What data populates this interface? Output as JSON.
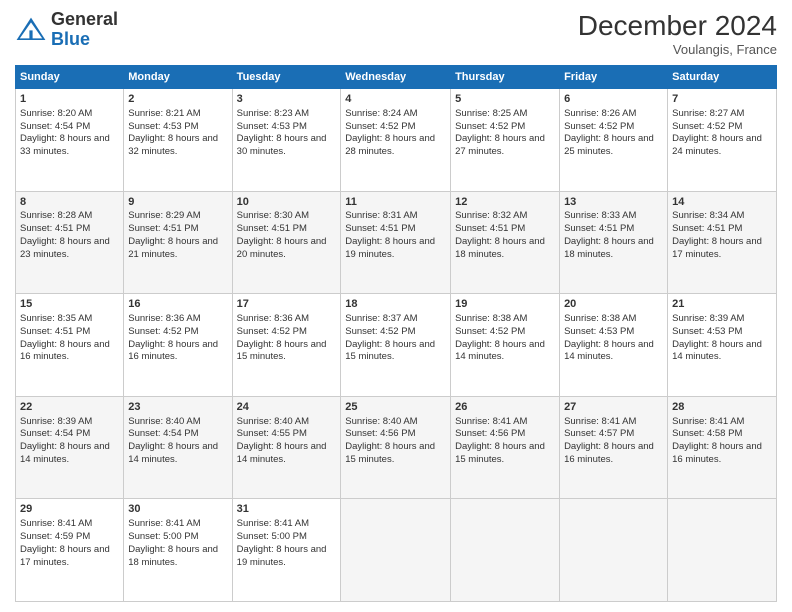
{
  "logo": {
    "line1": "General",
    "line2": "Blue"
  },
  "title": "December 2024",
  "location": "Voulangis, France",
  "days": [
    "Sunday",
    "Monday",
    "Tuesday",
    "Wednesday",
    "Thursday",
    "Friday",
    "Saturday"
  ],
  "weeks": [
    [
      {
        "day": "1",
        "sunrise": "Sunrise: 8:20 AM",
        "sunset": "Sunset: 4:54 PM",
        "daylight": "Daylight: 8 hours and 33 minutes."
      },
      {
        "day": "2",
        "sunrise": "Sunrise: 8:21 AM",
        "sunset": "Sunset: 4:53 PM",
        "daylight": "Daylight: 8 hours and 32 minutes."
      },
      {
        "day": "3",
        "sunrise": "Sunrise: 8:23 AM",
        "sunset": "Sunset: 4:53 PM",
        "daylight": "Daylight: 8 hours and 30 minutes."
      },
      {
        "day": "4",
        "sunrise": "Sunrise: 8:24 AM",
        "sunset": "Sunset: 4:52 PM",
        "daylight": "Daylight: 8 hours and 28 minutes."
      },
      {
        "day": "5",
        "sunrise": "Sunrise: 8:25 AM",
        "sunset": "Sunset: 4:52 PM",
        "daylight": "Daylight: 8 hours and 27 minutes."
      },
      {
        "day": "6",
        "sunrise": "Sunrise: 8:26 AM",
        "sunset": "Sunset: 4:52 PM",
        "daylight": "Daylight: 8 hours and 25 minutes."
      },
      {
        "day": "7",
        "sunrise": "Sunrise: 8:27 AM",
        "sunset": "Sunset: 4:52 PM",
        "daylight": "Daylight: 8 hours and 24 minutes."
      }
    ],
    [
      {
        "day": "8",
        "sunrise": "Sunrise: 8:28 AM",
        "sunset": "Sunset: 4:51 PM",
        "daylight": "Daylight: 8 hours and 23 minutes."
      },
      {
        "day": "9",
        "sunrise": "Sunrise: 8:29 AM",
        "sunset": "Sunset: 4:51 PM",
        "daylight": "Daylight: 8 hours and 21 minutes."
      },
      {
        "day": "10",
        "sunrise": "Sunrise: 8:30 AM",
        "sunset": "Sunset: 4:51 PM",
        "daylight": "Daylight: 8 hours and 20 minutes."
      },
      {
        "day": "11",
        "sunrise": "Sunrise: 8:31 AM",
        "sunset": "Sunset: 4:51 PM",
        "daylight": "Daylight: 8 hours and 19 minutes."
      },
      {
        "day": "12",
        "sunrise": "Sunrise: 8:32 AM",
        "sunset": "Sunset: 4:51 PM",
        "daylight": "Daylight: 8 hours and 18 minutes."
      },
      {
        "day": "13",
        "sunrise": "Sunrise: 8:33 AM",
        "sunset": "Sunset: 4:51 PM",
        "daylight": "Daylight: 8 hours and 18 minutes."
      },
      {
        "day": "14",
        "sunrise": "Sunrise: 8:34 AM",
        "sunset": "Sunset: 4:51 PM",
        "daylight": "Daylight: 8 hours and 17 minutes."
      }
    ],
    [
      {
        "day": "15",
        "sunrise": "Sunrise: 8:35 AM",
        "sunset": "Sunset: 4:51 PM",
        "daylight": "Daylight: 8 hours and 16 minutes."
      },
      {
        "day": "16",
        "sunrise": "Sunrise: 8:36 AM",
        "sunset": "Sunset: 4:52 PM",
        "daylight": "Daylight: 8 hours and 16 minutes."
      },
      {
        "day": "17",
        "sunrise": "Sunrise: 8:36 AM",
        "sunset": "Sunset: 4:52 PM",
        "daylight": "Daylight: 8 hours and 15 minutes."
      },
      {
        "day": "18",
        "sunrise": "Sunrise: 8:37 AM",
        "sunset": "Sunset: 4:52 PM",
        "daylight": "Daylight: 8 hours and 15 minutes."
      },
      {
        "day": "19",
        "sunrise": "Sunrise: 8:38 AM",
        "sunset": "Sunset: 4:52 PM",
        "daylight": "Daylight: 8 hours and 14 minutes."
      },
      {
        "day": "20",
        "sunrise": "Sunrise: 8:38 AM",
        "sunset": "Sunset: 4:53 PM",
        "daylight": "Daylight: 8 hours and 14 minutes."
      },
      {
        "day": "21",
        "sunrise": "Sunrise: 8:39 AM",
        "sunset": "Sunset: 4:53 PM",
        "daylight": "Daylight: 8 hours and 14 minutes."
      }
    ],
    [
      {
        "day": "22",
        "sunrise": "Sunrise: 8:39 AM",
        "sunset": "Sunset: 4:54 PM",
        "daylight": "Daylight: 8 hours and 14 minutes."
      },
      {
        "day": "23",
        "sunrise": "Sunrise: 8:40 AM",
        "sunset": "Sunset: 4:54 PM",
        "daylight": "Daylight: 8 hours and 14 minutes."
      },
      {
        "day": "24",
        "sunrise": "Sunrise: 8:40 AM",
        "sunset": "Sunset: 4:55 PM",
        "daylight": "Daylight: 8 hours and 14 minutes."
      },
      {
        "day": "25",
        "sunrise": "Sunrise: 8:40 AM",
        "sunset": "Sunset: 4:56 PM",
        "daylight": "Daylight: 8 hours and 15 minutes."
      },
      {
        "day": "26",
        "sunrise": "Sunrise: 8:41 AM",
        "sunset": "Sunset: 4:56 PM",
        "daylight": "Daylight: 8 hours and 15 minutes."
      },
      {
        "day": "27",
        "sunrise": "Sunrise: 8:41 AM",
        "sunset": "Sunset: 4:57 PM",
        "daylight": "Daylight: 8 hours and 16 minutes."
      },
      {
        "day": "28",
        "sunrise": "Sunrise: 8:41 AM",
        "sunset": "Sunset: 4:58 PM",
        "daylight": "Daylight: 8 hours and 16 minutes."
      }
    ],
    [
      {
        "day": "29",
        "sunrise": "Sunrise: 8:41 AM",
        "sunset": "Sunset: 4:59 PM",
        "daylight": "Daylight: 8 hours and 17 minutes."
      },
      {
        "day": "30",
        "sunrise": "Sunrise: 8:41 AM",
        "sunset": "Sunset: 5:00 PM",
        "daylight": "Daylight: 8 hours and 18 minutes."
      },
      {
        "day": "31",
        "sunrise": "Sunrise: 8:41 AM",
        "sunset": "Sunset: 5:00 PM",
        "daylight": "Daylight: 8 hours and 19 minutes."
      },
      null,
      null,
      null,
      null
    ]
  ]
}
